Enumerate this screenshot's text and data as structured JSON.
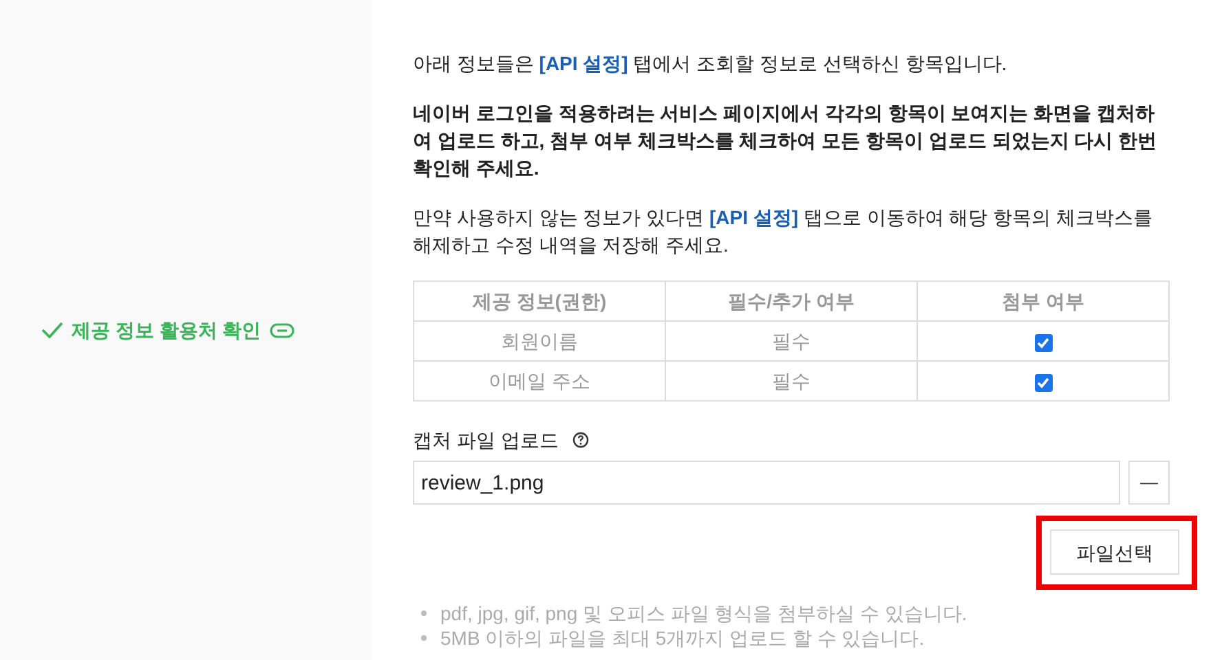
{
  "sidebar": {
    "title": "제공 정보 활용처 확인"
  },
  "intro": [
    {
      "kind": "text",
      "text": "아래 정보들은 "
    },
    {
      "kind": "link",
      "text": "[API 설정]"
    },
    {
      "kind": "text",
      "text": " 탭에서 조회할 정보로 선택하신 항목입니다."
    }
  ],
  "notice": "네이버 로그인을 적용하려는 서비스 페이지에서 각각의 항목이 보여지는 화면을 캡처하여 업로드 하고, 첨부 여부 체크박스를 체크하여 모든 항목이 업로드 되었는지 다시 한번 확인해 주세요.",
  "note": [
    {
      "kind": "text",
      "text": "만약 사용하지 않는 정보가 있다면 "
    },
    {
      "kind": "link",
      "text": "[API 설정]"
    },
    {
      "kind": "text",
      "text": " 탭으로 이동하여 해당 항목의 체크박스를 해제하고 수정 내역을 저장해 주세요."
    }
  ],
  "table": {
    "columns": [
      "제공 정보(권한)",
      "필수/추가 여부",
      "첨부 여부"
    ],
    "rows": [
      {
        "name": "회원이름",
        "requirement": "필수",
        "checked": true
      },
      {
        "name": "이메일 주소",
        "requirement": "필수",
        "checked": true
      }
    ]
  },
  "upload": {
    "label": "캡처 파일 업로드",
    "value": "review_1.png",
    "remove_button": "—",
    "choose_button": "파일선택"
  },
  "hints": [
    "pdf, jpg, gif, png 및 오피스 파일 형식을 첨부하실 수 있습니다.",
    "5MB 이하의 파일을 최대 5개까지 업로드 할 수 있습니다."
  ]
}
